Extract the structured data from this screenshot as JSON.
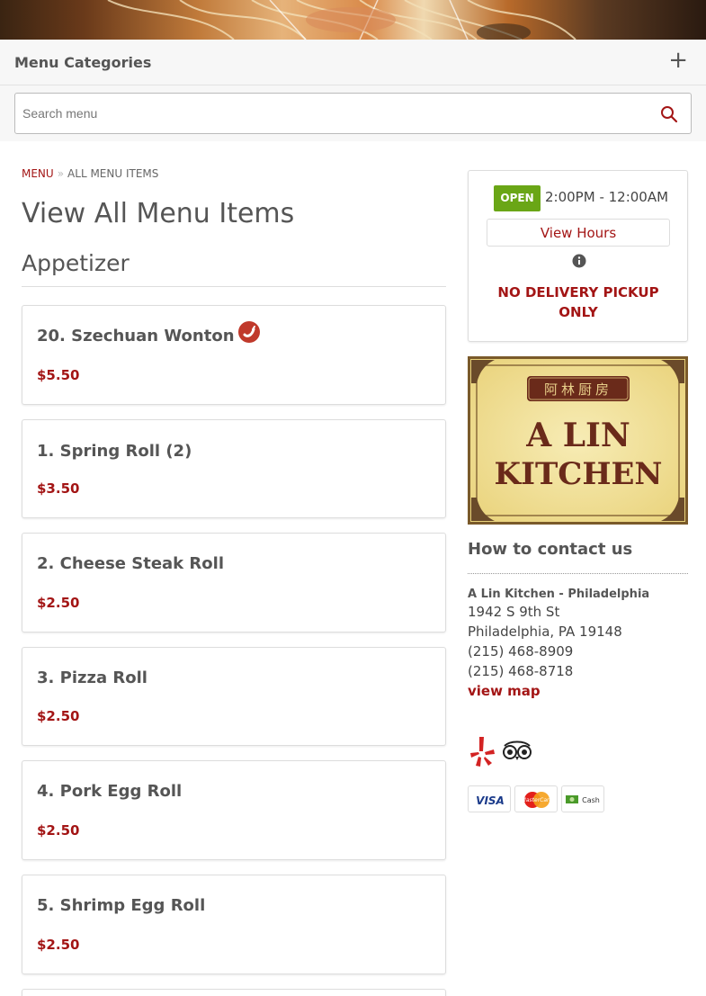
{
  "header": {
    "menu_categories_label": "Menu Categories",
    "expand_icon": "+"
  },
  "search": {
    "placeholder": "Search menu"
  },
  "breadcrumb": {
    "menu": "MENU",
    "current": "ALL MENU ITEMS"
  },
  "page_title": "View All Menu Items",
  "section": {
    "title": "Appetizer",
    "items": [
      {
        "name": "20. Szechuan Wonton",
        "price": "$5.50",
        "spicy": true
      },
      {
        "name": "1. Spring Roll (2)",
        "price": "$3.50",
        "spicy": false
      },
      {
        "name": "2. Cheese Steak Roll",
        "price": "$2.50",
        "spicy": false
      },
      {
        "name": "3. Pizza Roll",
        "price": "$2.50",
        "spicy": false
      },
      {
        "name": "4. Pork Egg Roll",
        "price": "$2.50",
        "spicy": false
      },
      {
        "name": "5. Shrimp Egg Roll",
        "price": "$2.50",
        "spicy": false
      }
    ]
  },
  "status": {
    "badge": "OPEN",
    "hours": "2:00PM - 12:00AM",
    "view_hours_label": "View Hours",
    "notice": "NO DELIVERY PICKUP ONLY"
  },
  "logo": {
    "chinese": "阿林厨房",
    "line1": "A LIN",
    "line2": "KITCHEN"
  },
  "contact": {
    "title": "How to contact us",
    "name": "A Lin Kitchen - Philadelphia",
    "address1": "1942 S 9th St",
    "address2": "Philadelphia, PA 19148",
    "phone1": "(215) 468-8909",
    "phone2": "(215) 468-8718",
    "view_map": "view map"
  },
  "payments": {
    "visa": "VISA",
    "mastercard": "MasterCard",
    "cash": "Cash"
  },
  "colors": {
    "accent": "#a31515",
    "open_green": "#6aa616",
    "text": "#555555"
  }
}
